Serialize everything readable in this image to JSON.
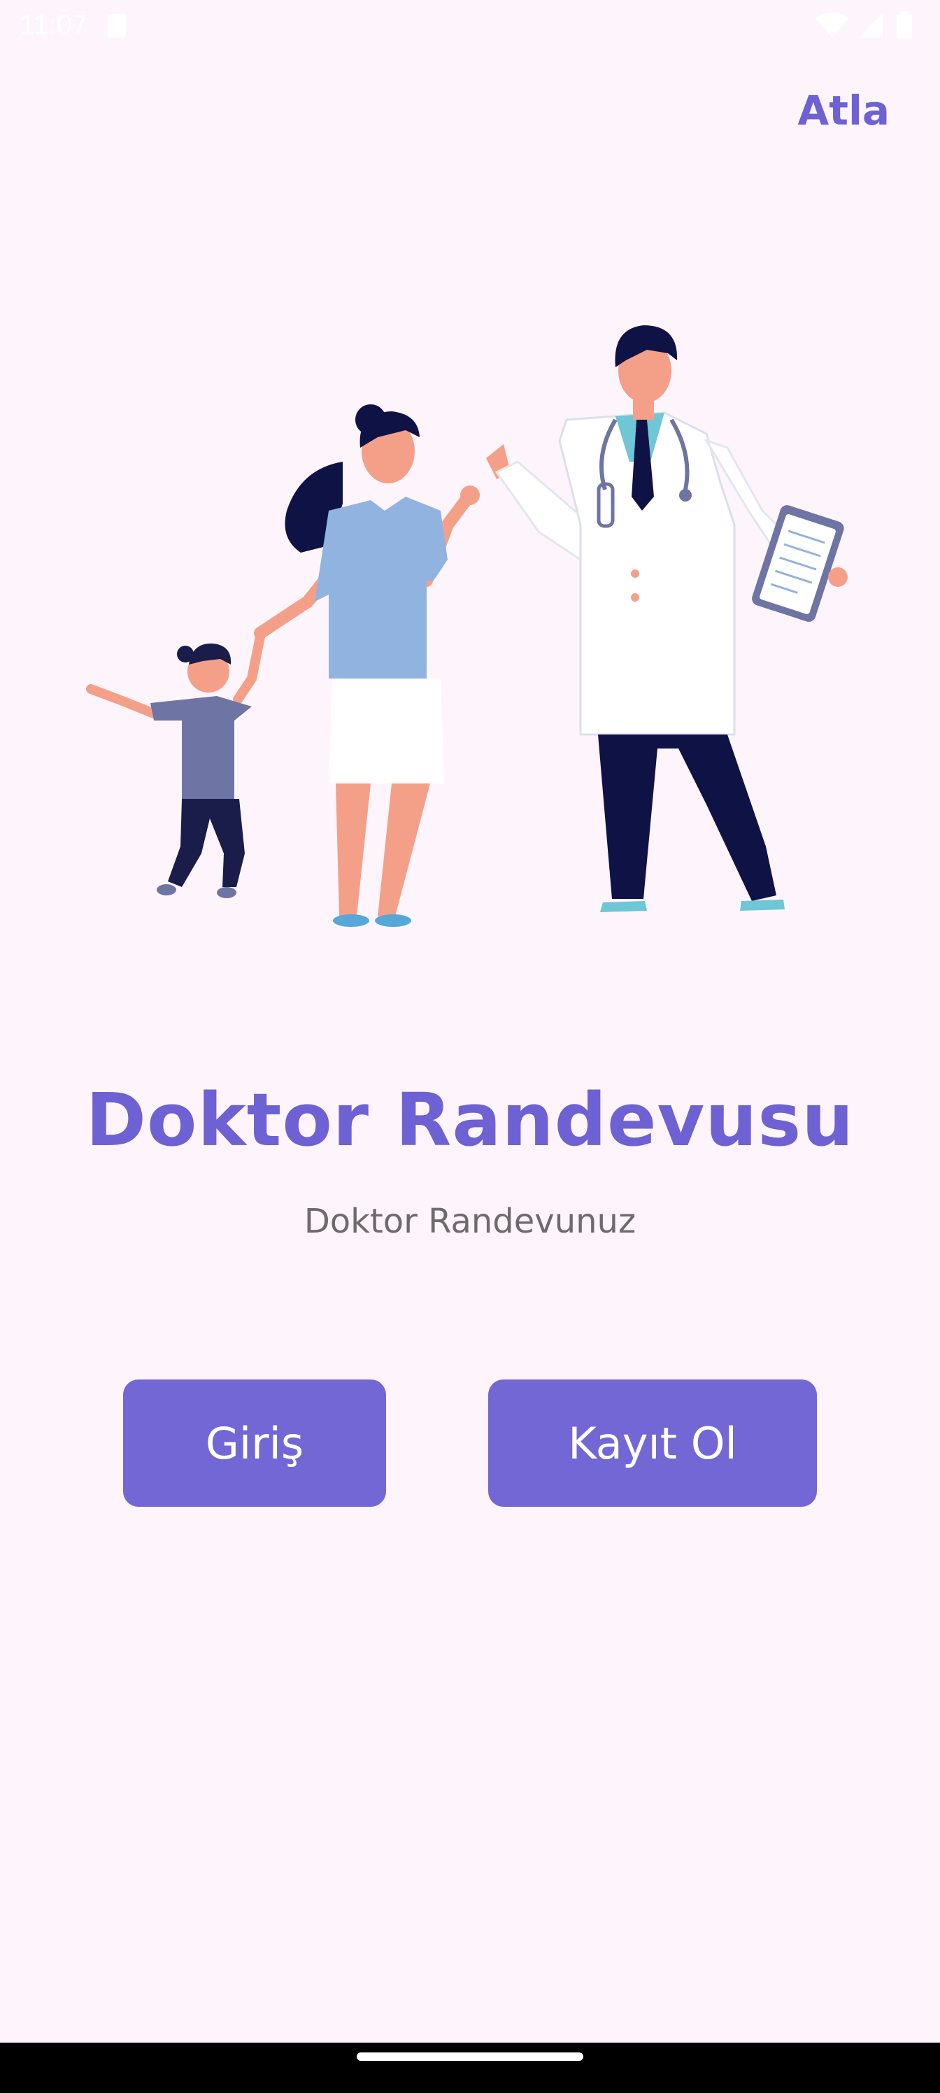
{
  "status_bar": {
    "time": "11:07",
    "icons": [
      "sim-card-icon",
      "wifi-icon",
      "signal-icon",
      "battery-icon"
    ]
  },
  "header": {
    "skip_label": "Atla"
  },
  "main": {
    "illustration_name": "doctor-family-illustration",
    "title": "Doktor Randevusu",
    "subtitle": "Doktor Randevunuz"
  },
  "actions": {
    "login_label": "Giriş",
    "register_label": "Kayıt Ol"
  },
  "colors": {
    "background": "#fdf5fb",
    "accent": "#6e61d3",
    "button": "#7367d6",
    "subtitle": "#6f6a6c"
  }
}
